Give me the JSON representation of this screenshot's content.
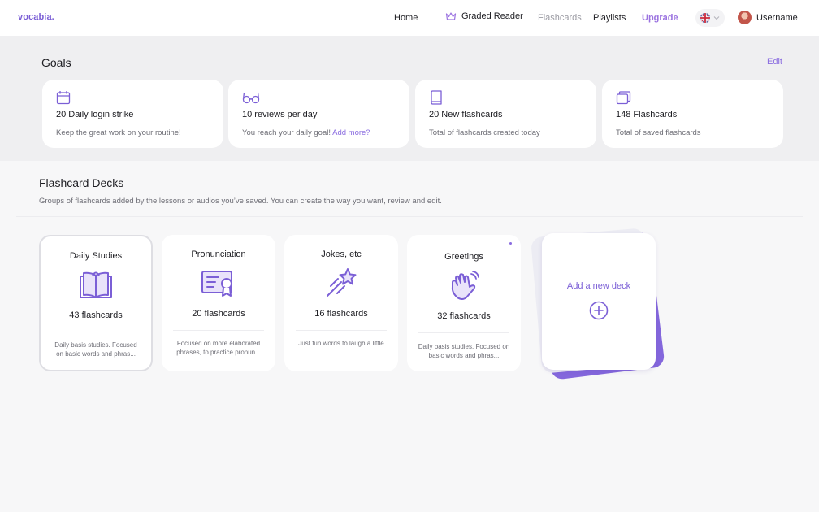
{
  "header": {
    "logo": "vocabia.",
    "nav": {
      "home": "Home",
      "graded_reader": "Graded Reader",
      "flashcards": "Flashcards",
      "playlists": "Playlists",
      "upgrade": "Upgrade"
    },
    "language_icon": "uk-flag-icon",
    "username": "Username"
  },
  "goals": {
    "title": "Goals",
    "edit_label": "Edit",
    "cards": [
      {
        "icon": "calendar-icon",
        "title": "20 Daily login strike",
        "subtitle": "Keep the great work on your routine!"
      },
      {
        "icon": "glasses-icon",
        "title": "10 reviews per day",
        "subtitle": "You reach your daily goal!",
        "link": "Add more?"
      },
      {
        "icon": "book-icon",
        "title": "20 New flashcards",
        "subtitle": "Total of flashcards created today"
      },
      {
        "icon": "stacked-cards-icon",
        "title": "148 Flashcards",
        "subtitle": "Total of saved flashcards"
      }
    ]
  },
  "decks": {
    "title": "Flashcard Decks",
    "description": "Groups of flashcards added by the lessons or audios you’ve saved. You can create the way you want, review and edit.",
    "items": [
      {
        "name": "Daily Studies",
        "icon": "open-book-icon",
        "count": "43 flashcards",
        "description": "Daily basis studies. Focused on basic words and phras..."
      },
      {
        "name": "Pronunciation",
        "icon": "certificate-icon",
        "count": "20 flashcards",
        "description": "Focused on more elaborated phrases, to practice pronun..."
      },
      {
        "name": "Jokes, etc",
        "icon": "shooting-star-icon",
        "count": "16 flashcards",
        "description": "Just fun words to laugh a little"
      },
      {
        "name": "Greetings",
        "icon": "waving-hand-icon",
        "count": "32 flashcards",
        "description": "Daily basis studies. Focused on basic words and phras..."
      }
    ],
    "add_label": "Add a new deck"
  },
  "colors": {
    "accent": "#7b5fd6",
    "upgrade": "#9b73e0",
    "muted": "#6d6d75"
  }
}
